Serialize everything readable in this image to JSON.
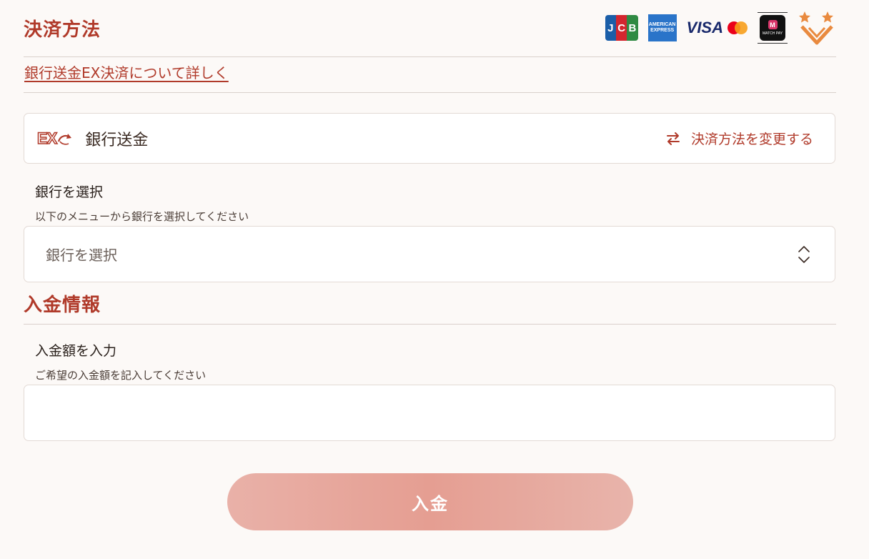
{
  "payment": {
    "title": "決済方法",
    "logos": {
      "jcb": [
        "J",
        "C",
        "B"
      ],
      "amex_line1": "AMERICAN",
      "amex_line2": "EXPRESS",
      "visa": "VISA",
      "match_mark": "M",
      "match_pay": "MATCH PAY"
    },
    "details_link": "銀行送金EX決済について詳しく",
    "method": {
      "logo_text": "EX",
      "name": "銀行送金",
      "change_label": "決済方法を変更する"
    },
    "bank": {
      "label": "銀行を選択",
      "help": "以下のメニューから銀行を選択してください",
      "selected": "銀行を選択"
    }
  },
  "deposit": {
    "title": "入金情報",
    "amount": {
      "label": "入金額を入力",
      "help": "ご希望の入金額を記入してください",
      "value": ""
    },
    "submit_label": "入金"
  },
  "colors": {
    "accent": "#b03a2a",
    "jcb_blue": "#1b5ea8",
    "jcb_red": "#d3262f",
    "jcb_green": "#2f8a43",
    "amex_blue": "#2a74c9",
    "mc_red": "#eb001b",
    "mc_orange": "#f79e1b",
    "star_orange": "#e98a3f"
  }
}
